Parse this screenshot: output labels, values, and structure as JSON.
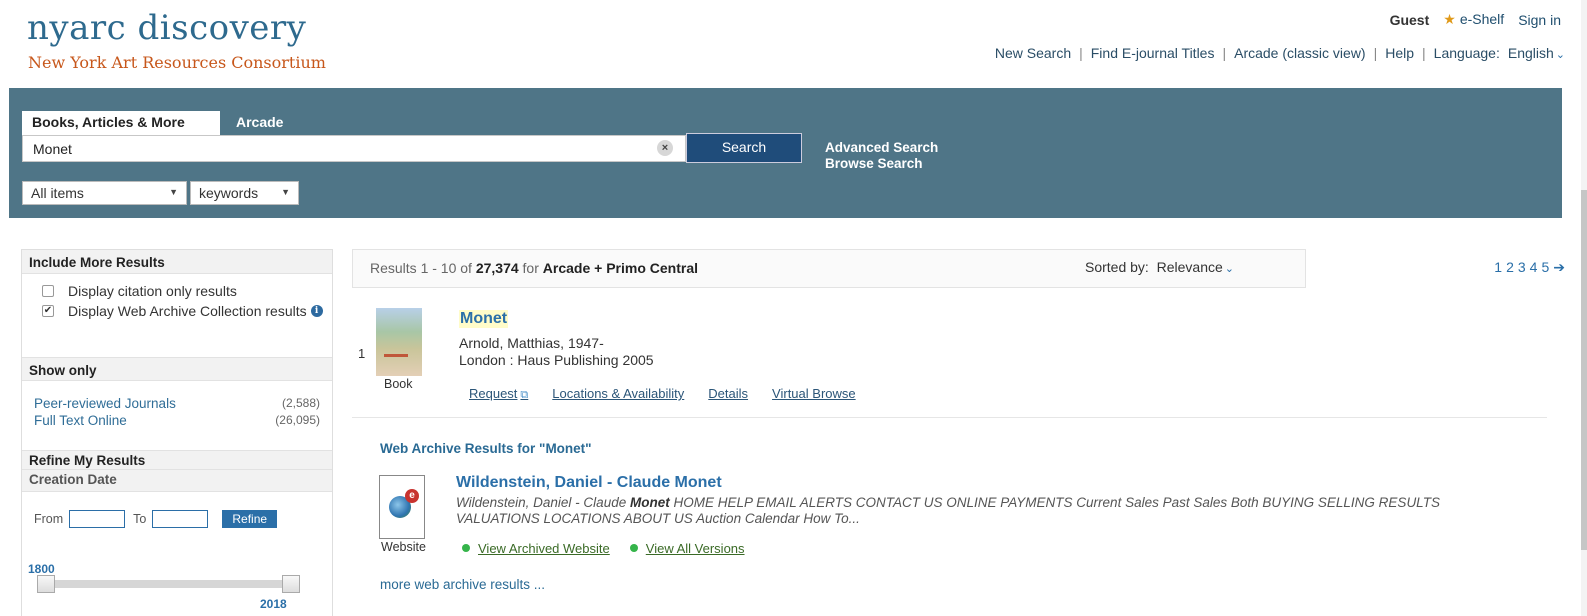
{
  "header": {
    "logo_title": "nyarc discovery",
    "logo_sub": "New York Art Resources Consortium",
    "user": "Guest",
    "eshelf": "e-Shelf",
    "signin": "Sign in",
    "nav": [
      "New Search",
      "Find E-journal Titles",
      "Arcade (classic view)",
      "Help"
    ],
    "language_label": "Language:",
    "language_value": "English"
  },
  "search": {
    "tabs": [
      "Books, Articles & More",
      "Arcade"
    ],
    "query": "Monet",
    "button": "Search",
    "advanced": "Advanced Search",
    "browse": "Browse Search",
    "scope": "All items",
    "field": "keywords"
  },
  "facets": {
    "include_head": "Include More Results",
    "include_items": [
      {
        "label": "Display citation only results",
        "checked": false
      },
      {
        "label": "Display Web Archive Collection results",
        "checked": true
      }
    ],
    "show_head": "Show only",
    "show_items": [
      {
        "label": "Peer-reviewed Journals",
        "count": "(2,588)"
      },
      {
        "label": "Full Text Online",
        "count": "(26,095)"
      }
    ],
    "refine_head": "Refine My Results",
    "date_head": "Creation Date",
    "from": "From",
    "to": "To",
    "refine_btn": "Refine",
    "range_min": "1800",
    "range_max": "2018"
  },
  "results": {
    "range": "Results 1 - 10 of",
    "total": "27,374",
    "for": "for",
    "scope": "Arcade + Primo Central",
    "sorted_label": "Sorted by:",
    "sorted_value": "Relevance",
    "pages": [
      "1",
      "2",
      "3",
      "4",
      "5"
    ],
    "record": {
      "num": "1",
      "format": "Book",
      "title": "Monet",
      "author": "Arnold, Matthias, 1947-",
      "pub": "London : Haus Publishing 2005",
      "links": [
        "Request",
        "Locations & Availability",
        "Details",
        "Virtual Browse"
      ]
    },
    "web_archive": {
      "head": "Web Archive Results for \"Monet\"",
      "format": "Website",
      "title": "Wildenstein, Daniel - Claude Monet",
      "desc_pre": "Wildenstein, Daniel - Claude ",
      "desc_bold": "Monet",
      "desc_post": " HOME HELP EMAIL ALERTS CONTACT US ONLINE PAYMENTS Current Sales Past Sales Both BUYING SELLING RESULTS VALUATIONS LOCATIONS ABOUT US Auction Calendar How To...",
      "links": [
        "View Archived Website",
        "View All Versions"
      ],
      "more": "more web archive results ..."
    }
  }
}
